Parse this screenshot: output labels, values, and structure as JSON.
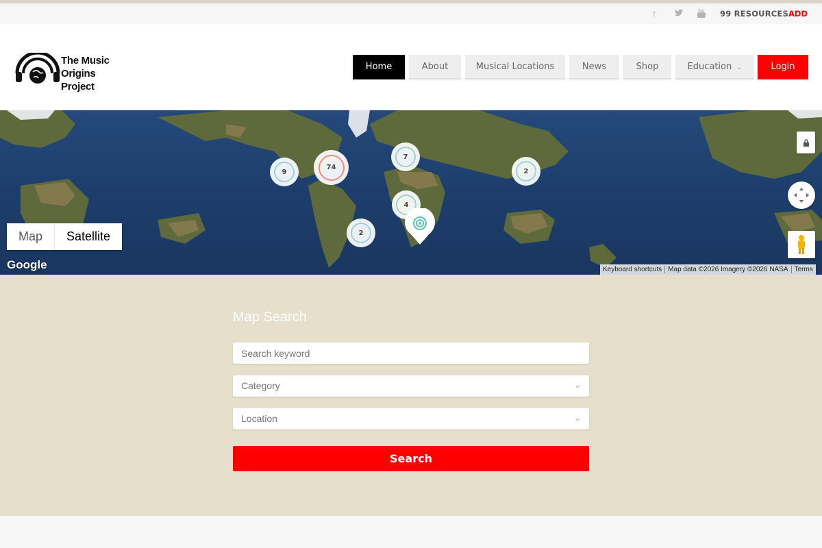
{
  "topbar": {
    "social": [
      {
        "icon": "facebook-icon",
        "glyph": "f"
      },
      {
        "icon": "twitter-icon",
        "glyph": "🐦"
      },
      {
        "icon": "youtube-icon",
        "glyph": "▶"
      }
    ],
    "resources_label": "99 RESOURCES",
    "separator": "|",
    "add_label": "ADD"
  },
  "logo": {
    "line1": "The Music",
    "line2": "Origins Project"
  },
  "nav": {
    "items": [
      {
        "label": "Home",
        "active": true
      },
      {
        "label": "About"
      },
      {
        "label": "Musical Locations"
      },
      {
        "label": "News"
      },
      {
        "label": "Shop"
      },
      {
        "label": "Education",
        "has_dropdown": true
      },
      {
        "label": "Login",
        "accent": "#ff0000"
      }
    ]
  },
  "map": {
    "clusters": [
      {
        "count": "9",
        "ring": "#9dd3d6"
      },
      {
        "count": "74",
        "ring": "#f08c7c"
      },
      {
        "count": "7",
        "ring": "#9dd3d6"
      },
      {
        "count": "2",
        "ring": "#9dd3d6"
      },
      {
        "count": "4",
        "ring": "#9dd3d6"
      },
      {
        "count": "2",
        "ring": "#9dd3d6"
      }
    ],
    "map_type": {
      "map": "Map",
      "satellite": "Satellite",
      "selected": "Satellite"
    },
    "google_logo": "Google",
    "attribution": {
      "shortcuts": "Keyboard shortcuts",
      "data": "Map data ©2026 Imagery ©2026 NASA",
      "terms": "Terms"
    },
    "controls": {
      "fullscreen_icon": "lock-icon",
      "pan_icon": "pan-arrows-icon",
      "pegman_icon": "pegman-icon"
    }
  },
  "search": {
    "title": "Map Search",
    "keyword_placeholder": "Search keyword",
    "category_value": "Category",
    "location_value": "Location",
    "button_label": "Search",
    "accent": "#ff0000"
  }
}
